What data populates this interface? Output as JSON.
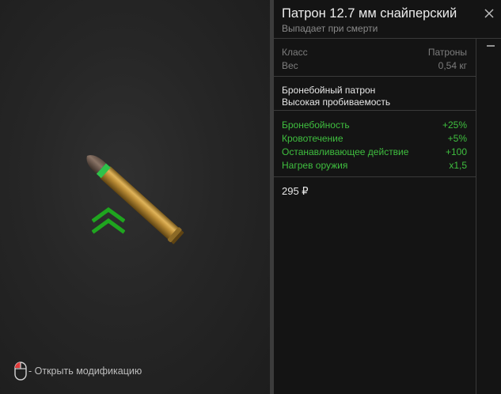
{
  "item": {
    "title": "Патрон 12.7 мм снайперский",
    "subtitle": "Выпадает при смерти",
    "image_icon": "sniper-bullet",
    "rarity_icon": "double-chevron-up",
    "rarity_color": "#1fa51f"
  },
  "stats": [
    {
      "label": "Класс",
      "value": "Патроны"
    },
    {
      "label": "Вес",
      "value": "0,54 кг"
    }
  ],
  "description": [
    "Бронебойный патрон",
    "Высокая пробиваемость"
  ],
  "modifiers": [
    {
      "label": "Бронебойность",
      "value": "+25%"
    },
    {
      "label": "Кровотечение",
      "value": "+5%"
    },
    {
      "label": "Останавливающее действие",
      "value": "+100"
    },
    {
      "label": "Нагрев оружия",
      "value": "x1,5"
    }
  ],
  "price": "295 ₽",
  "hint": {
    "icon": "mouse-left-click",
    "text": "- Открыть модификацию"
  },
  "colors": {
    "positive": "#3fbf3f",
    "muted": "#7d7d7d",
    "text": "#e6e6e6"
  }
}
